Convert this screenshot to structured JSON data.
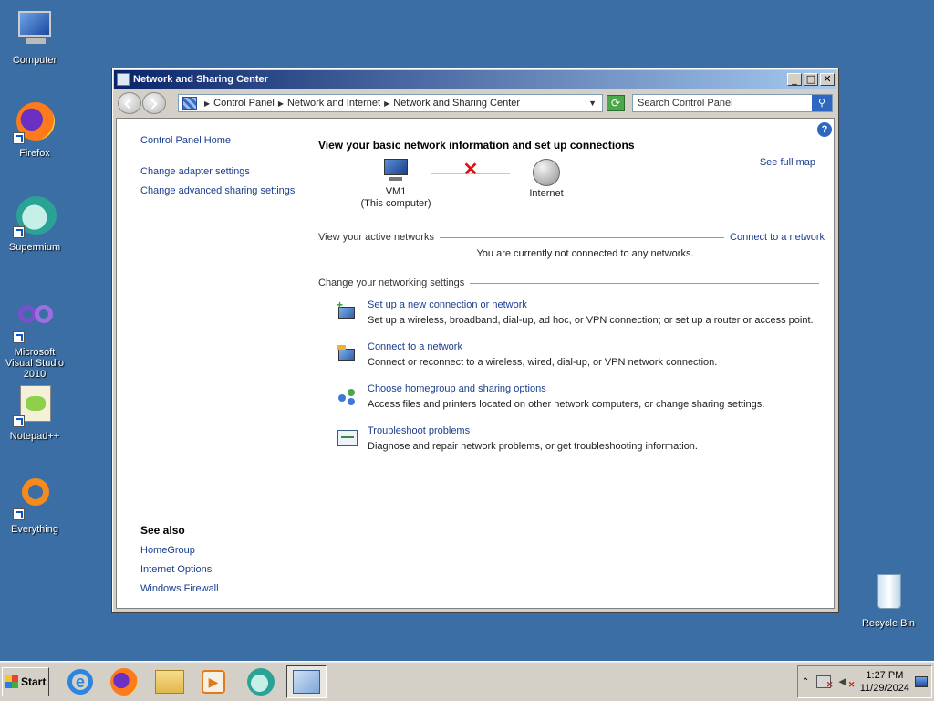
{
  "desktop": {
    "icons": [
      {
        "label": "Computer"
      },
      {
        "label": "Firefox"
      },
      {
        "label": "Supermium"
      },
      {
        "label": "Microsoft Visual Studio 2010"
      },
      {
        "label": "Notepad++"
      },
      {
        "label": "Everything"
      },
      {
        "label": "Recycle Bin"
      }
    ]
  },
  "window": {
    "title": "Network and Sharing Center",
    "controls": {
      "minimize": "_",
      "maximize": "□",
      "close": "✕"
    }
  },
  "address": {
    "crumbs": [
      "Control Panel",
      "Network and Internet",
      "Network and Sharing Center"
    ],
    "search_placeholder": "Search Control Panel"
  },
  "sidebar": {
    "home": "Control Panel Home",
    "links": [
      "Change adapter settings",
      "Change advanced sharing settings"
    ],
    "see_also_title": "See also",
    "see_also": [
      "HomeGroup",
      "Internet Options",
      "Windows Firewall"
    ]
  },
  "main": {
    "heading": "View your basic network information and set up connections",
    "see_full_map": "See full map",
    "computer_name": "VM1",
    "computer_sub": "(This computer)",
    "internet_label": "Internet",
    "active_networks_label": "View your active networks",
    "connect_link": "Connect to a network",
    "not_connected_msg": "You are currently not connected to any networks.",
    "change_settings_label": "Change your networking settings",
    "tasks": [
      {
        "title": "Set up a new connection or network",
        "desc": "Set up a wireless, broadband, dial-up, ad hoc, or VPN connection; or set up a router or access point."
      },
      {
        "title": "Connect to a network",
        "desc": "Connect or reconnect to a wireless, wired, dial-up, or VPN network connection."
      },
      {
        "title": "Choose homegroup and sharing options",
        "desc": "Access files and printers located on other network computers, or change sharing settings."
      },
      {
        "title": "Troubleshoot problems",
        "desc": "Diagnose and repair network problems, or get troubleshooting information."
      }
    ]
  },
  "taskbar": {
    "start_label": "Start",
    "clock_time": "1:27 PM",
    "clock_date": "11/29/2024"
  },
  "colors": {
    "desktop": "#3a6ea5",
    "link": "#1a3e8e",
    "title_start": "#0a246a",
    "title_end": "#a6caf0"
  }
}
